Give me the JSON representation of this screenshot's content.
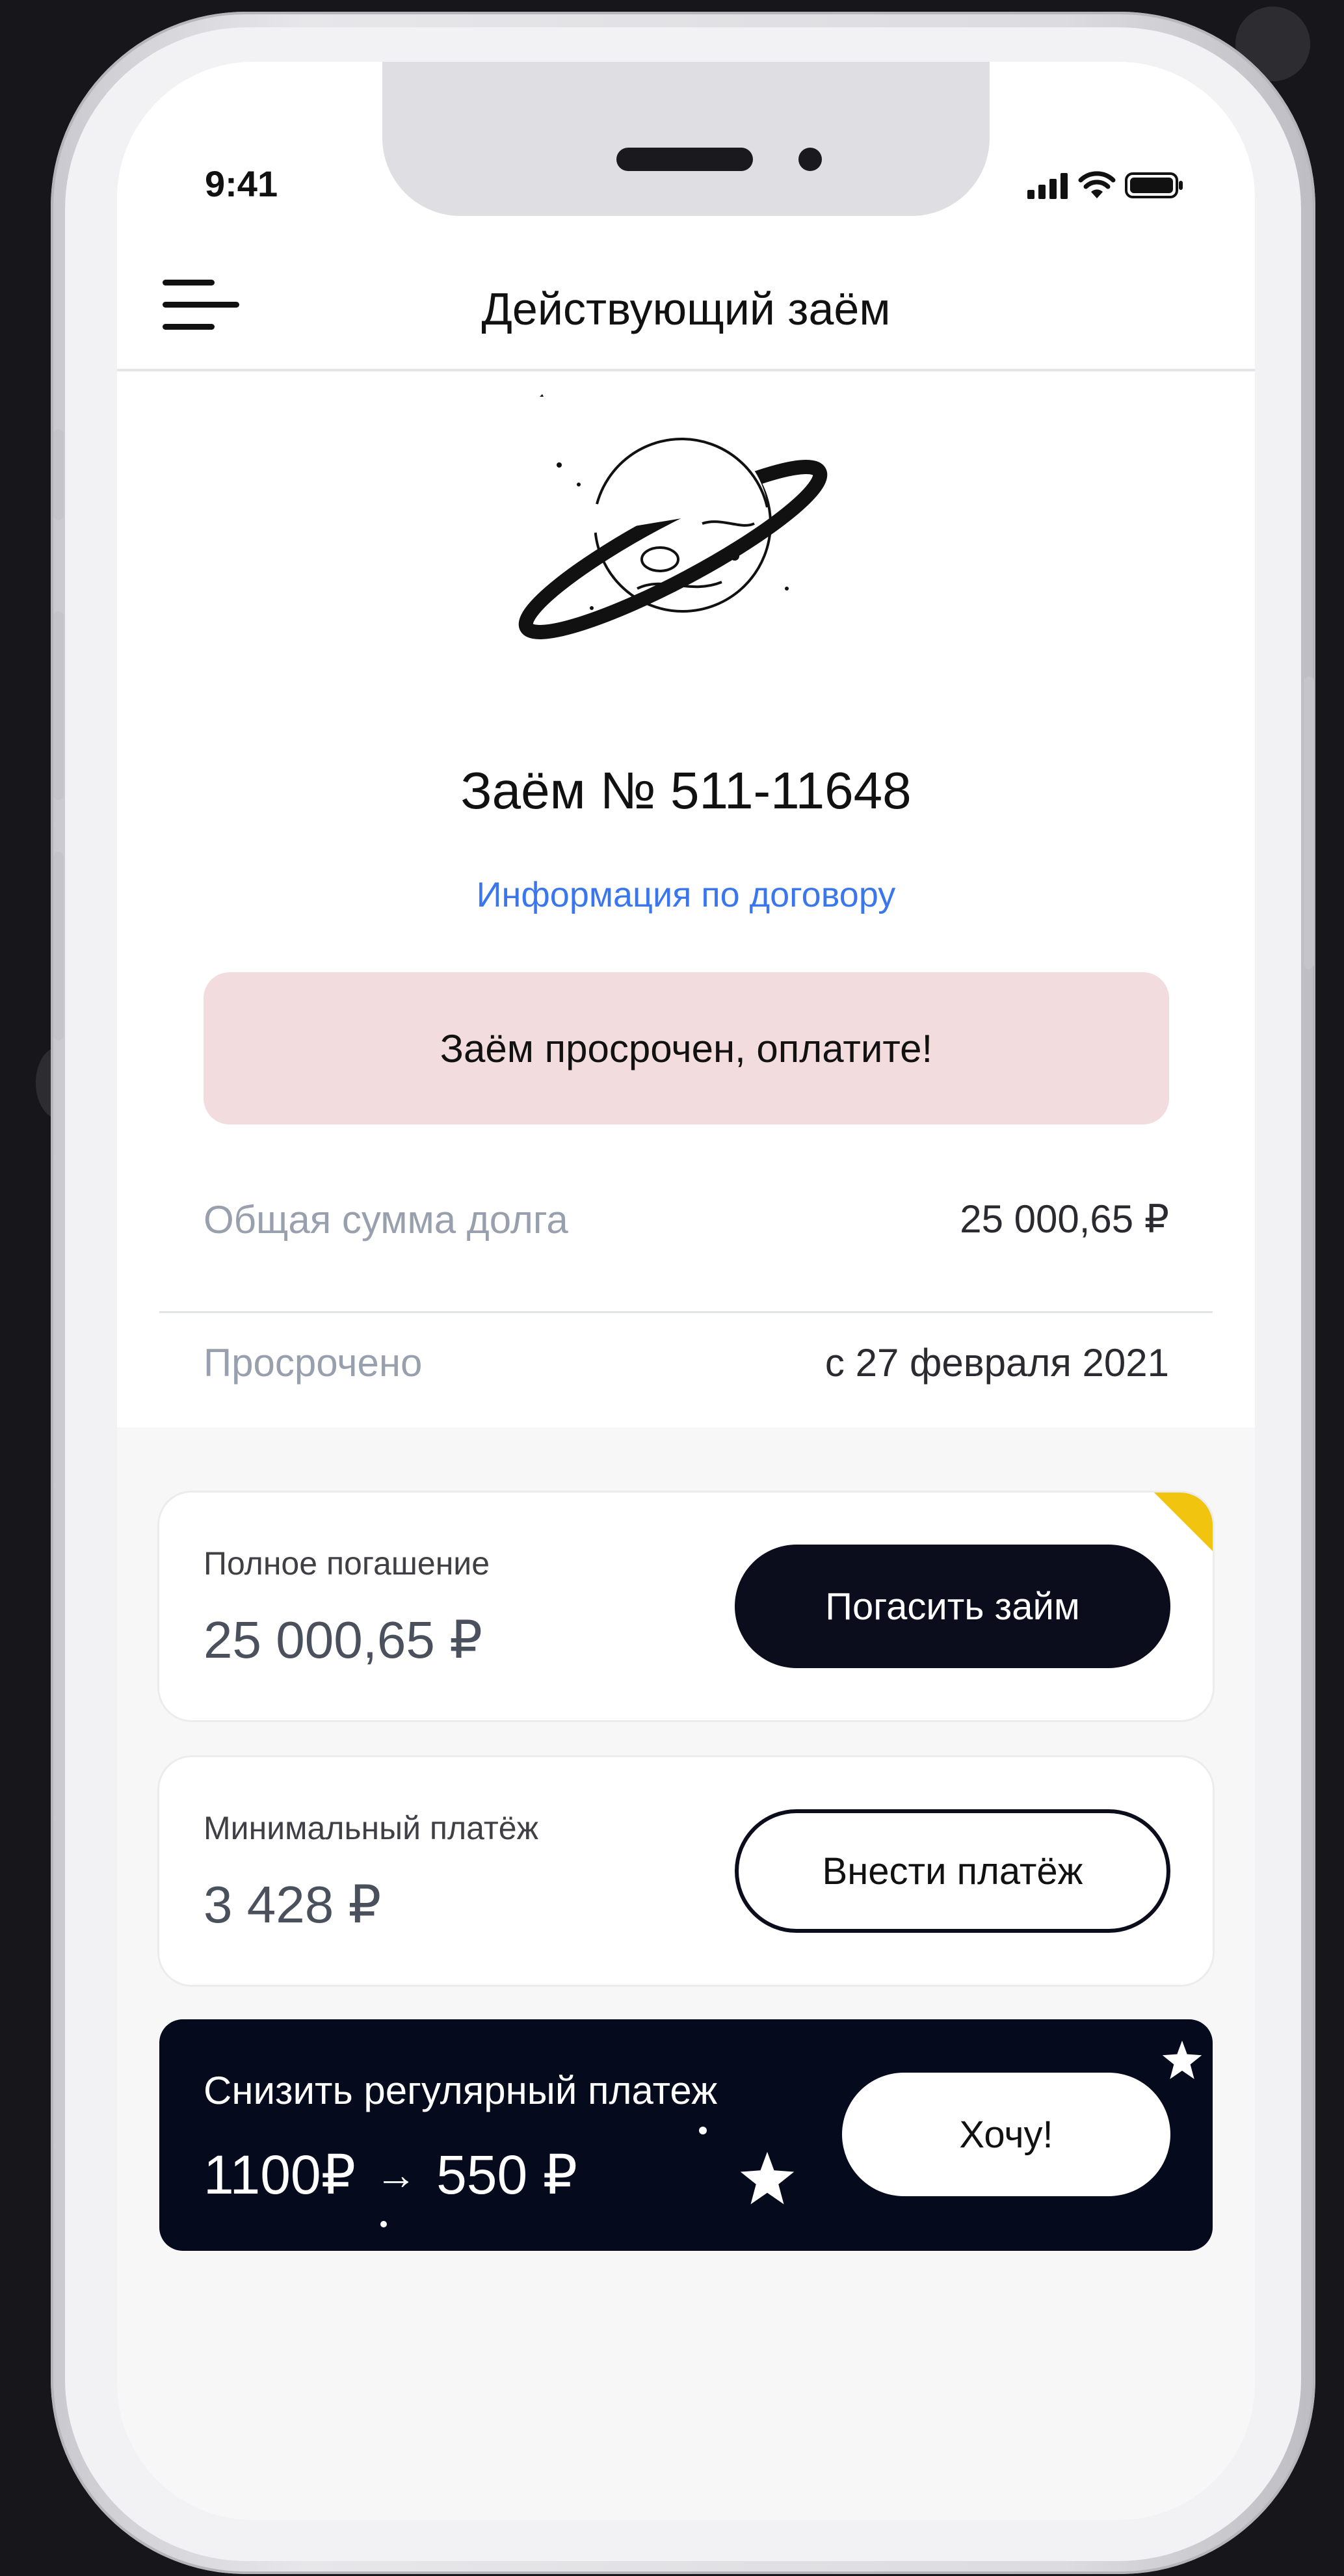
{
  "status_bar": {
    "time": "9:41"
  },
  "header": {
    "title": "Действующий заём"
  },
  "loan": {
    "number": "Заём № 511-11648",
    "info_link": "Информация по договору",
    "alert": "Заём просрочен, оплатите!"
  },
  "summary": {
    "rows": [
      {
        "label": "Общая сумма долга",
        "value": "25 000,65 ₽"
      },
      {
        "label": "Просрочено",
        "value": "с 27 февраля 2021"
      }
    ]
  },
  "cards": {
    "full": {
      "label": "Полное погашение",
      "amount": "25 000,65 ₽",
      "button": "Погасить займ"
    },
    "min": {
      "label": "Минимальный платёж",
      "amount": "3 428 ₽",
      "button": "Внести платёж"
    }
  },
  "promo": {
    "title": "Снизить регулярный платеж",
    "from": "1100₽",
    "arrow": "→",
    "to": "550 ₽",
    "button": "Хочу!"
  },
  "colors": {
    "link": "#3a77ef",
    "alert_bg": "#f2dcdd",
    "dark": "#0b0d1c",
    "accent": "#f1c40f"
  }
}
